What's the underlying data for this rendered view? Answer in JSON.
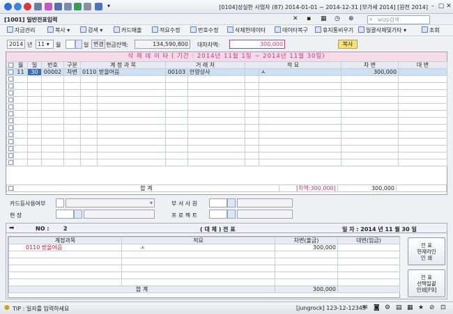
{
  "title": {
    "company": "[0104]성실한 사업자 (87) 2014-01-01 ~ 2014-12-31 [부가세 2014] [원천 2014]"
  },
  "screen": {
    "label": "[1001] 일반전표입력",
    "search_placeholder": "wizp검색"
  },
  "toolbar": [
    {
      "key": "F1",
      "label": "자금관리"
    },
    {
      "key": "F4",
      "label": "복사"
    },
    {
      "key": "F6",
      "label": "검색"
    },
    {
      "key": "F7",
      "label": "카드매출"
    },
    {
      "key": "F8",
      "label": "적요수정"
    },
    {
      "key": "SF2",
      "label": "번호수정"
    },
    {
      "key": "CF5",
      "label": "삭제한데이타"
    },
    {
      "key": "CF8",
      "label": "데이타복구"
    },
    {
      "key": "CF9",
      "label": "휴지통비우기"
    },
    {
      "key": "CF2",
      "label": "일괄삭제및기타"
    },
    {
      "key": "",
      "label": "조회"
    }
  ],
  "filter": {
    "year": "2014",
    "year_unit": "년",
    "month": "11",
    "month_unit": "월",
    "day_unit": "일",
    "change_btn": "변경",
    "cash_label": "현금잔액:",
    "cash_value": "134,590,800",
    "diff_label": "대차차액:",
    "diff_value": "300,000",
    "copy_btn": "복사"
  },
  "banner": "삭 제 데 이 타 ( 기간 : 2014년 11월 1일 ~ 2014년 11월 30일)",
  "grid": {
    "columns": [
      "일",
      "번호",
      "구분",
      "계 정 과 목",
      "",
      "거 래 처",
      "",
      "적 요",
      "차 변",
      "대 변"
    ],
    "month_header": "월",
    "rows": [
      {
        "month": "11",
        "day": "30",
        "no": "00002",
        "kind": "차변",
        "acc_code": "0110",
        "acc_name": "받을어음",
        "cust_code": "00103",
        "cust_name": "안양상사",
        "memo": "ㅅ",
        "debit": "300,000",
        "credit": ""
      }
    ],
    "total_label": "합 계",
    "total_diff": "[차액:300,000]",
    "total_debit": "300,000",
    "total_credit": ""
  },
  "midform": {
    "card_label": "카드등사용여부",
    "dept_label": "부 서 사 원",
    "site_label": "현 장",
    "project_label": "프 로 젝 트"
  },
  "voucher": {
    "no_label": "NO :",
    "no_value": "2",
    "title": "( 대 체 ) 전 표",
    "date": "일 자 : 2014 년 11 월 30 일",
    "columns": [
      "계정과목",
      "적요",
      "차변(출금)",
      "대변(입금)"
    ],
    "rows": [
      {
        "code": "0110",
        "name": "받을어음",
        "memo": "ㅅ",
        "debit": "300,000",
        "credit": ""
      }
    ],
    "total_label": "합 계",
    "total_debit": "300,000",
    "total_credit": "",
    "btn1": "전 표\n현재라인\n인 쇄",
    "btn2": "전 표\n선택일괄\n인쇄[F9]"
  },
  "status": {
    "tip": "TIP : 일자를 입력하세요",
    "info": "[jungrock] 123-12-12345"
  },
  "colors": {
    "accent": "#d23080",
    "highlight": "#cfe0f3",
    "copy_btn": "#f7e07a"
  }
}
